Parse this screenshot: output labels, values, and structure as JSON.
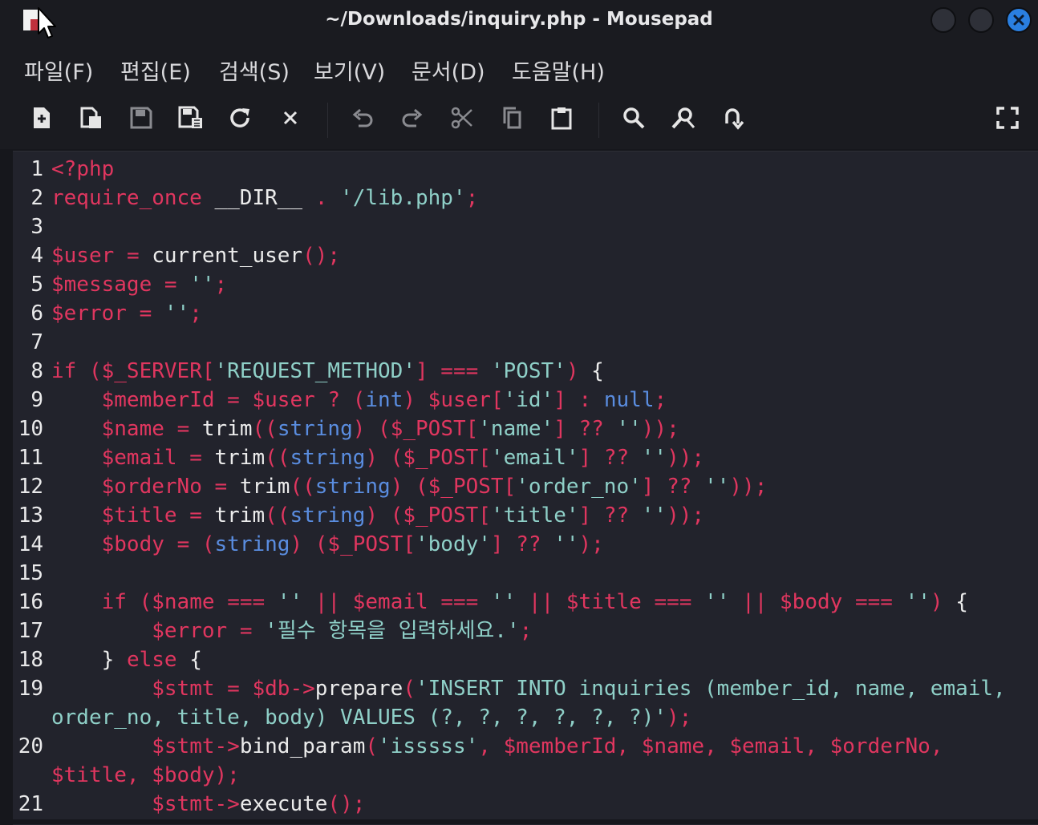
{
  "window": {
    "title": "~/Downloads/inquiry.php - Mousepad",
    "accent": "#2a7fe0"
  },
  "menu": [
    "파일(F)",
    "편집(E)",
    "검색(S)",
    "보기(V)",
    "문서(D)",
    "도움말(H)"
  ],
  "toolbar": {
    "icons": [
      "new-document-icon",
      "new-window-icon",
      "save-icon",
      "save-as-icon",
      "reload-icon",
      "close-icon",
      "undo-icon",
      "redo-icon",
      "cut-icon",
      "copy-icon",
      "paste-icon",
      "search-icon",
      "find-replace-icon",
      "go-to-line-icon",
      "fullscreen-icon"
    ]
  },
  "editor": {
    "colors": {
      "keyword": "#e0365f",
      "string": "#8fd0c8",
      "type": "#5a8de0",
      "plain": "#ececec",
      "background": "#22232c"
    },
    "lines": [
      {
        "n": "1",
        "code": "<?php"
      },
      {
        "n": "2",
        "code": "require_once __DIR__ . '/lib.php';"
      },
      {
        "n": "3",
        "code": ""
      },
      {
        "n": "4",
        "code": "$user = current_user();"
      },
      {
        "n": "5",
        "code": "$message = '';"
      },
      {
        "n": "6",
        "code": "$error = '';"
      },
      {
        "n": "7",
        "code": ""
      },
      {
        "n": "8",
        "code": "if ($_SERVER['REQUEST_METHOD'] === 'POST') {"
      },
      {
        "n": "9",
        "code": "    $memberId = $user ? (int) $user['id'] : null;"
      },
      {
        "n": "10",
        "code": "    $name = trim((string) ($_POST['name'] ?? ''));"
      },
      {
        "n": "11",
        "code": "    $email = trim((string) ($_POST['email'] ?? ''));"
      },
      {
        "n": "12",
        "code": "    $orderNo = trim((string) ($_POST['order_no'] ?? ''));"
      },
      {
        "n": "13",
        "code": "    $title = trim((string) ($_POST['title'] ?? ''));"
      },
      {
        "n": "14",
        "code": "    $body = (string) ($_POST['body'] ?? '');"
      },
      {
        "n": "15",
        "code": ""
      },
      {
        "n": "16",
        "code": "    if ($name === '' || $email === '' || $title === '' || $body === '') {"
      },
      {
        "n": "17",
        "code": "        $error = '필수 항목을 입력하세요.';"
      },
      {
        "n": "18",
        "code": "    } else {"
      },
      {
        "n": "19",
        "code": "        $stmt = $db->prepare('INSERT INTO inquiries (member_id, name, email,"
      },
      {
        "n": "",
        "code": "order_no, title, body) VALUES (?, ?, ?, ?, ?, ?)');"
      },
      {
        "n": "20",
        "code": "        $stmt->bind_param('isssss', $memberId, $name, $email, $orderNo,"
      },
      {
        "n": "",
        "code": "$title, $body);"
      },
      {
        "n": "21",
        "code": "        $stmt->execute();"
      }
    ]
  }
}
